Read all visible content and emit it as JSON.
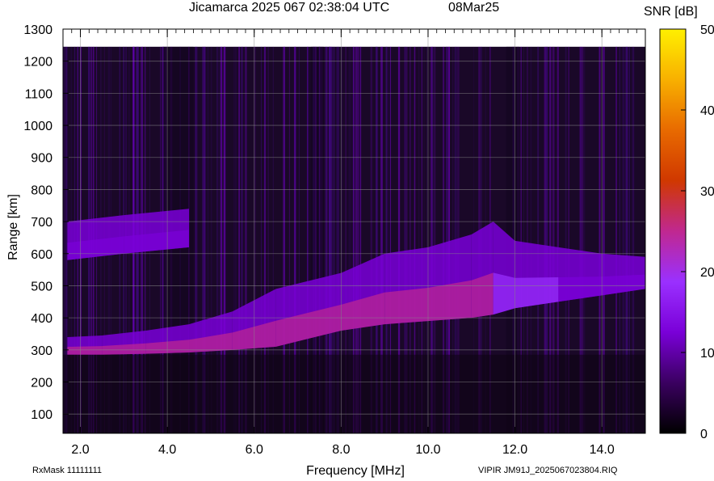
{
  "title": {
    "left": "Jicamarca 2025 067 02:38:04 UTC",
    "right": "08Mar25"
  },
  "colorbar": {
    "label": "SNR [dB]",
    "ticks": [
      "50",
      "40",
      "30",
      "20",
      "10",
      "0"
    ],
    "range": [
      0,
      50
    ],
    "colormap": [
      "#000000",
      "#3a0060",
      "#7a00d8",
      "#9a30ff",
      "#c02890",
      "#d03800",
      "#e86a00",
      "#f8b000",
      "#fff000"
    ]
  },
  "footer": {
    "left": "RxMask 11111111",
    "right": "VIPIR  JM91J_2025067023804.RIQ"
  },
  "chart_data": {
    "type": "heatmap",
    "title": "Jicamarca 2025 067 02:38:04 UTC",
    "xlabel": "Frequency [MHz]",
    "ylabel": "Range [km]",
    "xlim": [
      1.6,
      15.0
    ],
    "ylim": [
      40,
      1300
    ],
    "x_ticks": [
      "2.0",
      "4.0",
      "6.0",
      "8.0",
      "10.0",
      "12.0",
      "14.0"
    ],
    "y_ticks": [
      "100",
      "200",
      "300",
      "400",
      "500",
      "600",
      "700",
      "800",
      "900",
      "1000",
      "1100",
      "1200",
      "1300"
    ],
    "colorbar_label": "SNR [dB]",
    "colorbar_range": [
      0,
      50
    ],
    "echo_trace": [
      {
        "freq": 1.7,
        "range_bottom": 285,
        "range_top": 340,
        "snr": 24
      },
      {
        "freq": 2.5,
        "range_bottom": 285,
        "range_top": 345,
        "snr": 26
      },
      {
        "freq": 3.5,
        "range_bottom": 288,
        "range_top": 360,
        "snr": 24
      },
      {
        "freq": 4.5,
        "range_bottom": 292,
        "range_top": 380,
        "snr": 22
      },
      {
        "freq": 5.5,
        "range_bottom": 300,
        "range_top": 420,
        "snr": 27
      },
      {
        "freq": 6.5,
        "range_bottom": 310,
        "range_top": 490,
        "snr": 28
      },
      {
        "freq": 8.0,
        "range_bottom": 360,
        "range_top": 540,
        "snr": 26
      },
      {
        "freq": 9.0,
        "range_bottom": 380,
        "range_top": 600,
        "snr": 26
      },
      {
        "freq": 10.0,
        "range_bottom": 390,
        "range_top": 620,
        "snr": 26
      },
      {
        "freq": 11.0,
        "range_bottom": 400,
        "range_top": 660,
        "snr": 24
      },
      {
        "freq": 11.5,
        "range_bottom": 410,
        "range_top": 700,
        "snr": 25
      },
      {
        "freq": 12.0,
        "range_bottom": 430,
        "range_top": 640,
        "snr": 18
      },
      {
        "freq": 13.0,
        "range_bottom": 450,
        "range_top": 620,
        "snr": 15
      },
      {
        "freq": 14.0,
        "range_bottom": 470,
        "range_top": 600,
        "snr": 14
      },
      {
        "freq": 15.0,
        "range_bottom": 490,
        "range_top": 590,
        "snr": 13
      }
    ],
    "echo_second_hop": [
      {
        "freq": 1.7,
        "range_bottom": 580,
        "range_top": 700,
        "snr": 16
      },
      {
        "freq": 3.0,
        "range_bottom": 600,
        "range_top": 720,
        "snr": 14
      },
      {
        "freq": 4.5,
        "range_bottom": 620,
        "range_top": 740,
        "snr": 12
      }
    ],
    "grid": true
  }
}
